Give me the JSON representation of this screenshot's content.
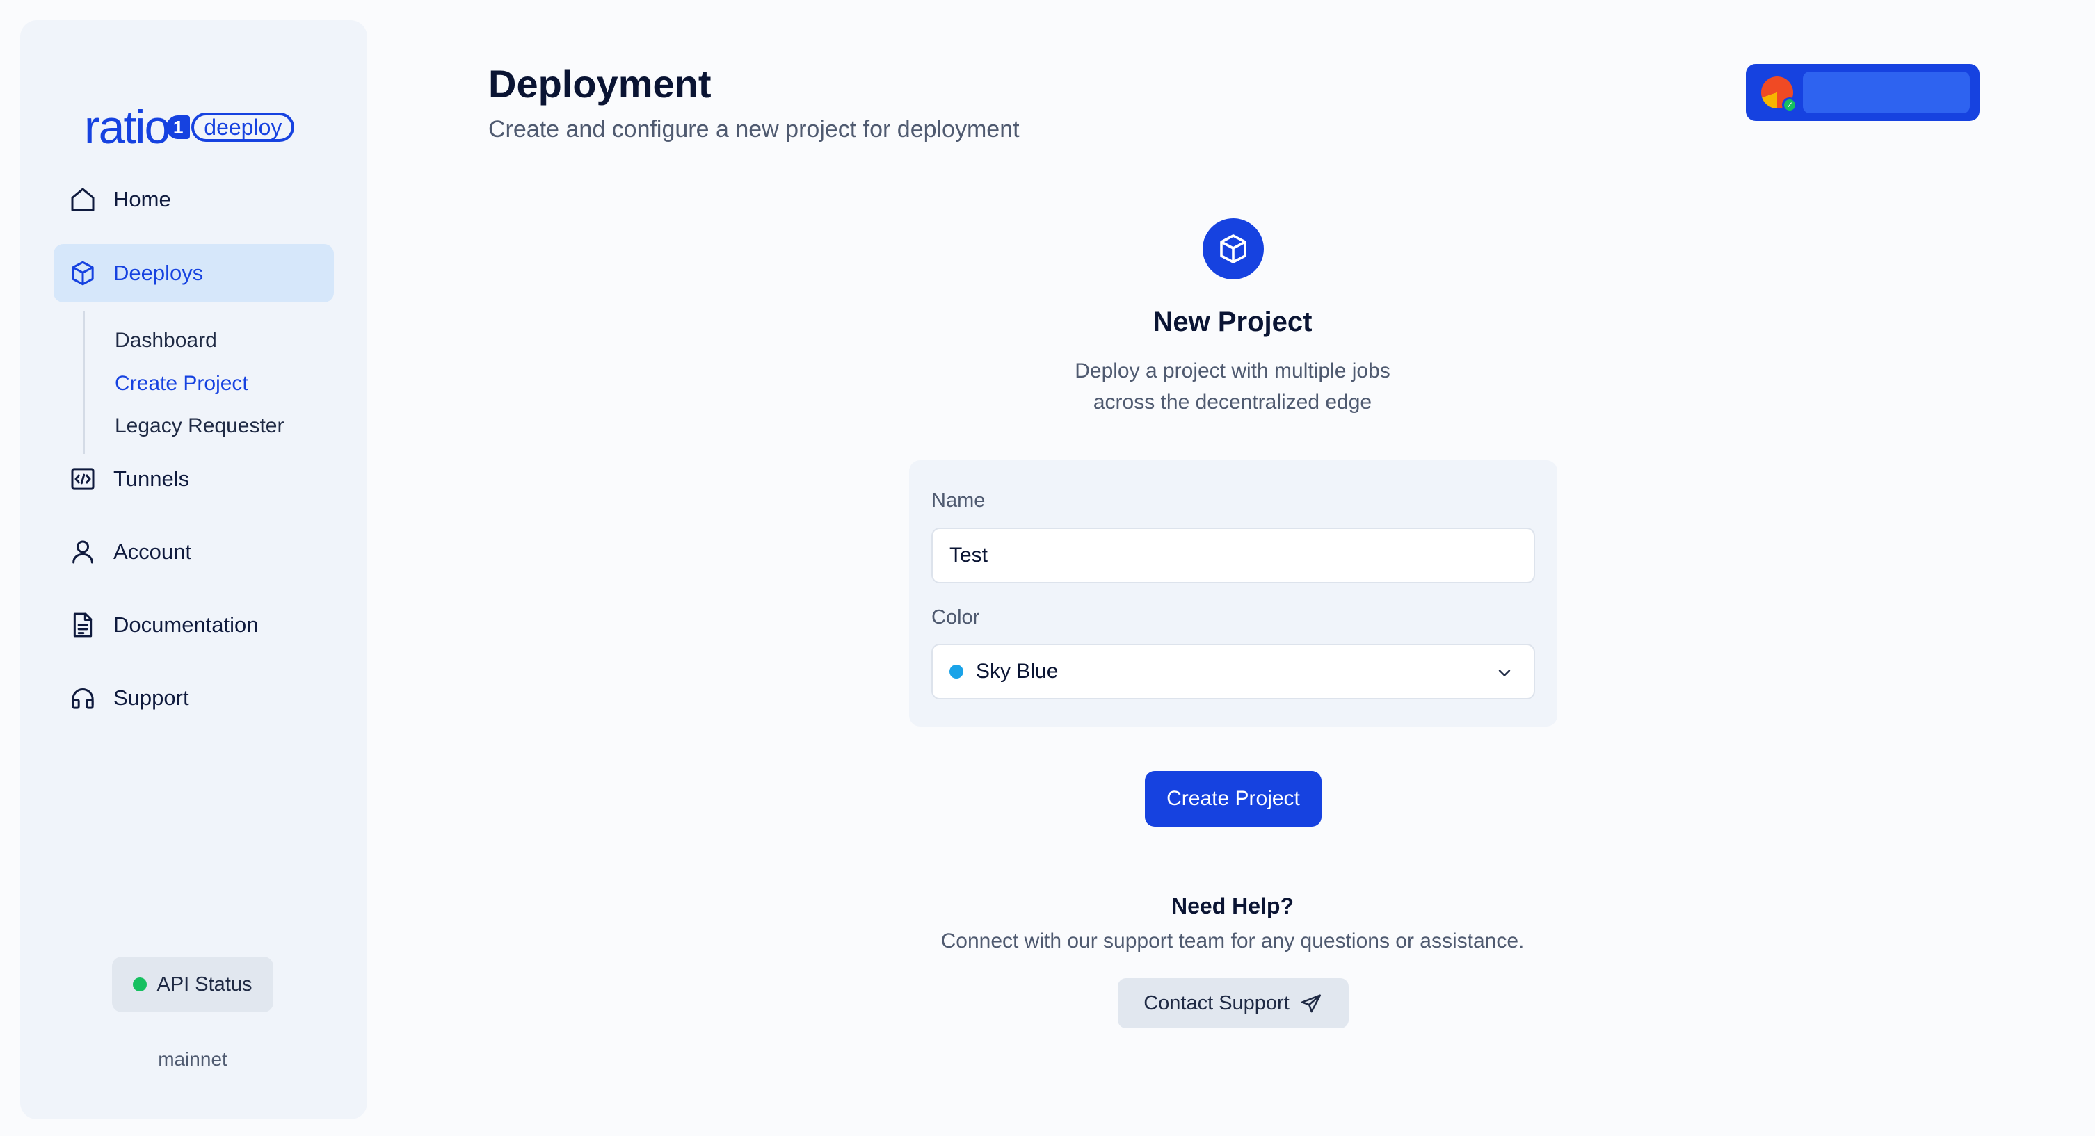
{
  "sidebar": {
    "logo": {
      "word": "ratio",
      "badge": "1",
      "product": "deeploy"
    },
    "items": [
      {
        "label": "Home",
        "icon": "home-icon"
      },
      {
        "label": "Deeploys",
        "icon": "cube-icon",
        "active": true
      },
      {
        "label": "Tunnels",
        "icon": "code-window-icon"
      },
      {
        "label": "Account",
        "icon": "user-icon"
      },
      {
        "label": "Documentation",
        "icon": "document-icon"
      },
      {
        "label": "Support",
        "icon": "headset-icon"
      }
    ],
    "sub_items": [
      {
        "label": "Dashboard"
      },
      {
        "label": "Create Project",
        "active": true
      },
      {
        "label": "Legacy Requester"
      }
    ],
    "api_status": {
      "label": "API Status",
      "status_color": "#16c060"
    },
    "network": "mainnet"
  },
  "header": {
    "title": "Deployment",
    "subtitle": "Create and configure a new project for deployment"
  },
  "project": {
    "icon": "cube-icon",
    "title": "New Project",
    "description_line1": "Deploy a project with multiple jobs",
    "description_line2": "across the decentralized edge"
  },
  "form": {
    "name_label": "Name",
    "name_value": "Test",
    "color_label": "Color",
    "color_value": "Sky Blue",
    "color_swatch": "#1aa3e8"
  },
  "actions": {
    "create_label": "Create Project"
  },
  "help": {
    "title": "Need Help?",
    "description": "Connect with our support team for any questions or assistance.",
    "contact_label": "Contact Support"
  },
  "colors": {
    "accent": "#1642e0",
    "active_bg": "#d6e7fa",
    "sidebar_bg": "#f0f4fa"
  }
}
